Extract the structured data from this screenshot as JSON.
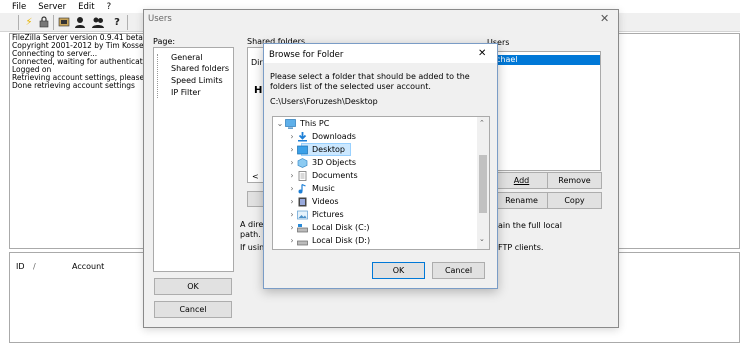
{
  "menu": [
    "File",
    "Server",
    "Edit",
    "?"
  ],
  "log": [
    "FileZilla Server version 0.9.41 beta",
    "Copyright 2001-2012 by Tim Kosse (tim",
    "Connecting to server...",
    "Connected, waiting for authentication",
    "Logged on",
    "Retrieving account settings, please wa",
    "Done retrieving account settings"
  ],
  "connections": {
    "id_header": "ID",
    "sort_glyph": "/",
    "account_header": "Account"
  },
  "users_dialog": {
    "title": "Users",
    "page_label": "Page:",
    "pages": [
      "General",
      "Shared folders",
      "Speed Limits",
      "IP Filter"
    ],
    "shared_folders_label": "Shared folders",
    "dir_fragment": "Dir",
    "h_fragment": "H",
    "left_scroll_glyph": "<",
    "users_label": "Users",
    "selected_user": "chael",
    "buttons": {
      "add": "Add",
      "remove": "Remove",
      "rename": "Rename",
      "copy": "Copy",
      "ok": "OK",
      "cancel": "Cancel"
    },
    "info_left_1": "A direc",
    "info_left_2": "path. S",
    "info_left_3": "If using",
    "info_right_1": "ain the full local",
    "info_right_2": "FTP clients."
  },
  "browse_dialog": {
    "title": "Browse for Folder",
    "instruction": "Please select a folder that should be added to the folders list of the selected user account.",
    "current_path": "C:\\Users\\Foruzesh\\Desktop",
    "tree": [
      {
        "label": "This PC",
        "icon": "computer-icon",
        "expanded": true,
        "selected": false
      },
      {
        "label": "Downloads",
        "icon": "downloads-icon",
        "expanded": false,
        "selected": false
      },
      {
        "label": "Desktop",
        "icon": "desktop-icon",
        "expanded": false,
        "selected": true
      },
      {
        "label": "3D Objects",
        "icon": "3d-objects-icon",
        "expanded": false,
        "selected": false
      },
      {
        "label": "Documents",
        "icon": "documents-icon",
        "expanded": false,
        "selected": false
      },
      {
        "label": "Music",
        "icon": "music-icon",
        "expanded": false,
        "selected": false
      },
      {
        "label": "Videos",
        "icon": "videos-icon",
        "expanded": false,
        "selected": false
      },
      {
        "label": "Pictures",
        "icon": "pictures-icon",
        "expanded": false,
        "selected": false
      },
      {
        "label": "Local Disk (C:)",
        "icon": "drive-icon",
        "expanded": false,
        "selected": false
      },
      {
        "label": "Local Disk (D:)",
        "icon": "drive-icon",
        "expanded": false,
        "selected": false
      }
    ],
    "ok_label": "OK",
    "cancel_label": "Cancel",
    "close_glyph": "✕"
  },
  "colors": {
    "accent": "#0078d7",
    "selection": "#cce8ff",
    "selection_border": "#99d1ff"
  }
}
